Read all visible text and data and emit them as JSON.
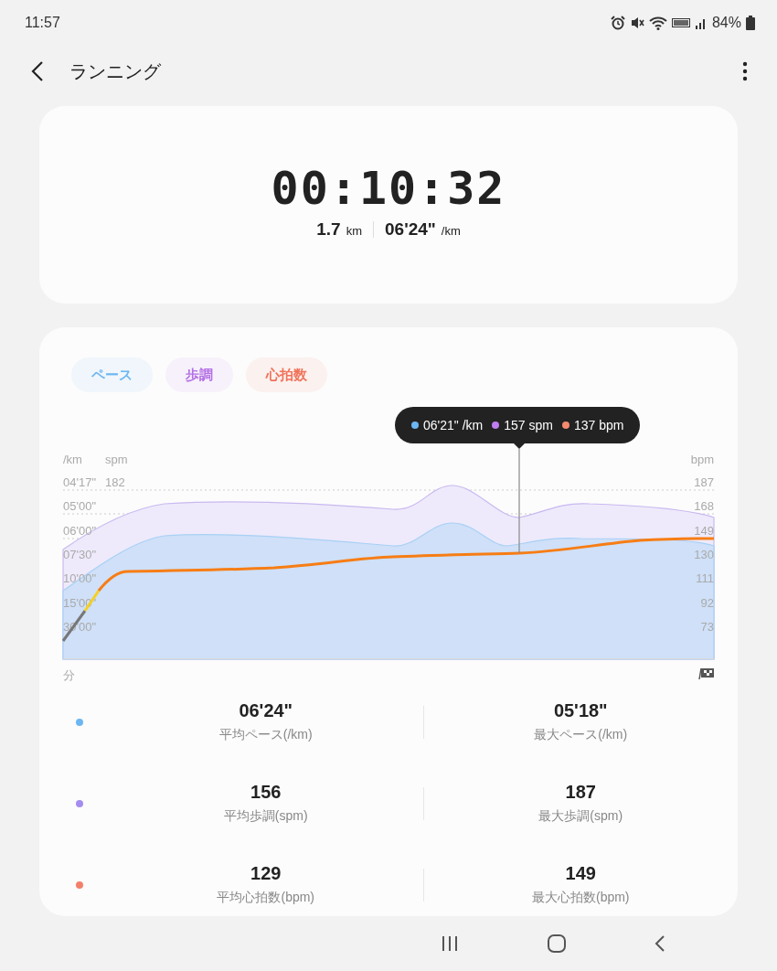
{
  "status_bar": {
    "time": "11:57",
    "battery": "84%"
  },
  "app_bar": {
    "title": "ランニング"
  },
  "summary": {
    "duration": "00:10:32",
    "distance": "1.7",
    "distance_unit": "km",
    "pace": "06'24\"",
    "pace_unit": "/km"
  },
  "chart": {
    "legend": [
      {
        "label": "ペース",
        "color": "#6cb6f2"
      },
      {
        "label": "歩調",
        "color": "#b46fe6"
      },
      {
        "label": "心拍数",
        "color": "#f0735a"
      }
    ],
    "tooltip": [
      {
        "text": "06'21\" /km",
        "color": "#6cb6f2"
      },
      {
        "text": "157 spm",
        "color": "#c07cf0"
      },
      {
        "text": "137 bpm",
        "color": "#f58a6e"
      }
    ],
    "left_unit": "/km",
    "mid_unit": "spm",
    "right_unit": "bpm",
    "left_ticks": [
      "04'17\"",
      "05'00\"",
      "06'00\"",
      "07'30\"",
      "10'00\"",
      "15'00\"",
      "30'00\""
    ],
    "mid_ticks": [
      "182"
    ],
    "right_ticks": [
      "187",
      "168",
      "149",
      "130",
      "111",
      "92",
      "73"
    ],
    "x_label": "分"
  },
  "stats": [
    {
      "color": "#6cb6f2",
      "avg": "06'24\"",
      "avg_label": "平均ペース(/km)",
      "max": "05'18\"",
      "max_label": "最大ペース(/km)"
    },
    {
      "color": "#a58cf0",
      "avg": "156",
      "avg_label": "平均歩調(spm)",
      "max": "187",
      "max_label": "最大歩調(spm)"
    },
    {
      "color": "#f3806a",
      "avg": "129",
      "avg_label": "平均心拍数(bpm)",
      "max": "149",
      "max_label": "最大心拍数(bpm)"
    }
  ]
}
